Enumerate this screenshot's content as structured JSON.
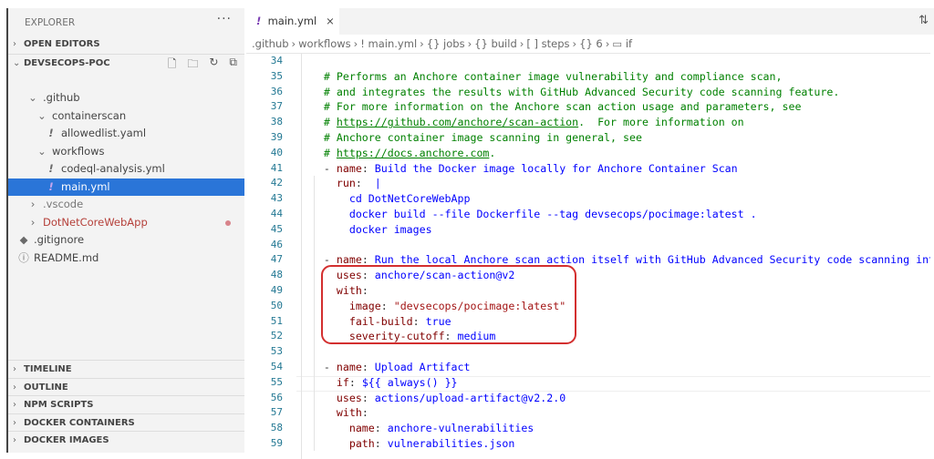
{
  "sidebar": {
    "title": "EXPLORER",
    "more": "···",
    "open_editors": "OPEN EDITORS",
    "project": "DEVSECOPS-POC",
    "tree": [
      {
        "label": ".github",
        "indent": 1,
        "icon": "chevron-down"
      },
      {
        "label": "containerscan",
        "indent": 2,
        "icon": "chevron-down"
      },
      {
        "label": "allowedlist.yaml",
        "indent": 3,
        "icon": "yaml"
      },
      {
        "label": "workflows",
        "indent": 2,
        "icon": "chevron-down"
      },
      {
        "label": "codeql-analysis.yml",
        "indent": 3,
        "icon": "yaml"
      },
      {
        "label": "main.yml",
        "indent": 3,
        "icon": "yaml",
        "selected": true
      },
      {
        "label": ".vscode",
        "indent": 1,
        "icon": "chevron-right"
      },
      {
        "label": "DotNetCoreWebApp",
        "indent": 1,
        "icon": "chevron-right",
        "modified": true
      },
      {
        "label": ".gitignore",
        "indent": 0,
        "icon": "git"
      },
      {
        "label": "README.md",
        "indent": 0,
        "icon": "info"
      }
    ],
    "sections": [
      "TIMELINE",
      "OUTLINE",
      "NPM SCRIPTS",
      "DOCKER CONTAINERS",
      "DOCKER IMAGES"
    ]
  },
  "tab": {
    "label": "main.yml",
    "close": "×",
    "icon": "!"
  },
  "breadcrumbs": [
    ".github",
    "workflows",
    "! main.yml",
    "{} jobs",
    "{} build",
    "[ ] steps",
    "{} 6",
    "▭ if"
  ],
  "colors": {
    "selection": "#2a75d8",
    "highlight_box": "#d32f2f",
    "comment": "#008000",
    "key": "#800000",
    "value": "#0000ff",
    "string": "#a31515"
  },
  "code": [
    {
      "n": "34",
      "seg": []
    },
    {
      "n": "35",
      "seg": [
        [
          "    ",
          ""
        ],
        [
          "# Performs an Anchore container image vulnerability and compliance scan,",
          "c"
        ]
      ]
    },
    {
      "n": "36",
      "seg": [
        [
          "    ",
          ""
        ],
        [
          "# and integrates the results with GitHub Advanced Security code scanning feature.",
          "c"
        ]
      ]
    },
    {
      "n": "37",
      "seg": [
        [
          "    ",
          ""
        ],
        [
          "# For more information on the Anchore scan action usage and parameters, see",
          "c"
        ]
      ]
    },
    {
      "n": "38",
      "seg": [
        [
          "    ",
          ""
        ],
        [
          "# ",
          "c"
        ],
        [
          "https://github.com/anchore/scan-action",
          "u"
        ],
        [
          ".  For more information on",
          "c"
        ]
      ]
    },
    {
      "n": "39",
      "seg": [
        [
          "    ",
          ""
        ],
        [
          "# Anchore container image scanning in general, see",
          "c"
        ]
      ]
    },
    {
      "n": "40",
      "seg": [
        [
          "    ",
          ""
        ],
        [
          "# ",
          "c"
        ],
        [
          "https://docs.anchore.com",
          "u"
        ],
        [
          ".",
          "c"
        ]
      ]
    },
    {
      "n": "41",
      "seg": [
        [
          "    - ",
          ""
        ],
        [
          "name",
          "k"
        ],
        [
          ": ",
          ""
        ],
        [
          "Build the Docker image locally for Anchore Container Scan",
          "v"
        ]
      ]
    },
    {
      "n": "42",
      "seg": [
        [
          "      ",
          ""
        ],
        [
          "run",
          "k"
        ],
        [
          ":  ",
          ""
        ],
        [
          "|",
          "v"
        ]
      ]
    },
    {
      "n": "43",
      "seg": [
        [
          "        ",
          ""
        ],
        [
          "cd DotNetCoreWebApp",
          "v"
        ]
      ]
    },
    {
      "n": "44",
      "seg": [
        [
          "        ",
          ""
        ],
        [
          "docker build --file Dockerfile --tag devsecops/pocimage:latest .",
          "v"
        ]
      ]
    },
    {
      "n": "45",
      "seg": [
        [
          "        ",
          ""
        ],
        [
          "docker images",
          "v"
        ]
      ]
    },
    {
      "n": "46",
      "seg": []
    },
    {
      "n": "47",
      "seg": [
        [
          "    - ",
          ""
        ],
        [
          "name",
          "k"
        ],
        [
          ": ",
          ""
        ],
        [
          "Run the local Anchore scan action itself with GitHub Advanced Security code scanning integration",
          "v"
        ]
      ]
    },
    {
      "n": "48",
      "seg": [
        [
          "      ",
          ""
        ],
        [
          "uses",
          "k"
        ],
        [
          ": ",
          ""
        ],
        [
          "anchore/scan-action@v2",
          "v"
        ]
      ]
    },
    {
      "n": "49",
      "seg": [
        [
          "      ",
          ""
        ],
        [
          "with",
          "k"
        ],
        [
          ":",
          ""
        ]
      ]
    },
    {
      "n": "50",
      "seg": [
        [
          "        ",
          ""
        ],
        [
          "image",
          "k"
        ],
        [
          ": ",
          ""
        ],
        [
          "\"devsecops/pocimage:latest\"",
          "s"
        ]
      ]
    },
    {
      "n": "51",
      "seg": [
        [
          "        ",
          ""
        ],
        [
          "fail-build",
          "k"
        ],
        [
          ": ",
          ""
        ],
        [
          "true",
          "v"
        ]
      ]
    },
    {
      "n": "52",
      "seg": [
        [
          "        ",
          ""
        ],
        [
          "severity-cutoff",
          "k"
        ],
        [
          ": ",
          ""
        ],
        [
          "medium",
          "v"
        ]
      ]
    },
    {
      "n": "53",
      "seg": []
    },
    {
      "n": "54",
      "seg": [
        [
          "    - ",
          ""
        ],
        [
          "name",
          "k"
        ],
        [
          ": ",
          ""
        ],
        [
          "Upload Artifact",
          "v"
        ]
      ]
    },
    {
      "n": "55",
      "seg": [
        [
          "      ",
          ""
        ],
        [
          "if",
          "k"
        ],
        [
          ": ",
          ""
        ],
        [
          "${{ always() }}",
          "v"
        ]
      ]
    },
    {
      "n": "56",
      "seg": [
        [
          "      ",
          ""
        ],
        [
          "uses",
          "k"
        ],
        [
          ": ",
          ""
        ],
        [
          "actions/upload-artifact@v2.2.0",
          "v"
        ]
      ]
    },
    {
      "n": "57",
      "seg": [
        [
          "      ",
          ""
        ],
        [
          "with",
          "k"
        ],
        [
          ":",
          ""
        ]
      ]
    },
    {
      "n": "58",
      "seg": [
        [
          "        ",
          ""
        ],
        [
          "name",
          "k"
        ],
        [
          ": ",
          ""
        ],
        [
          "anchore-vulnerabilities",
          "v"
        ]
      ]
    },
    {
      "n": "59",
      "seg": [
        [
          "        ",
          ""
        ],
        [
          "path",
          "k"
        ],
        [
          ": ",
          ""
        ],
        [
          "vulnerabilities.json",
          "v"
        ]
      ]
    }
  ]
}
